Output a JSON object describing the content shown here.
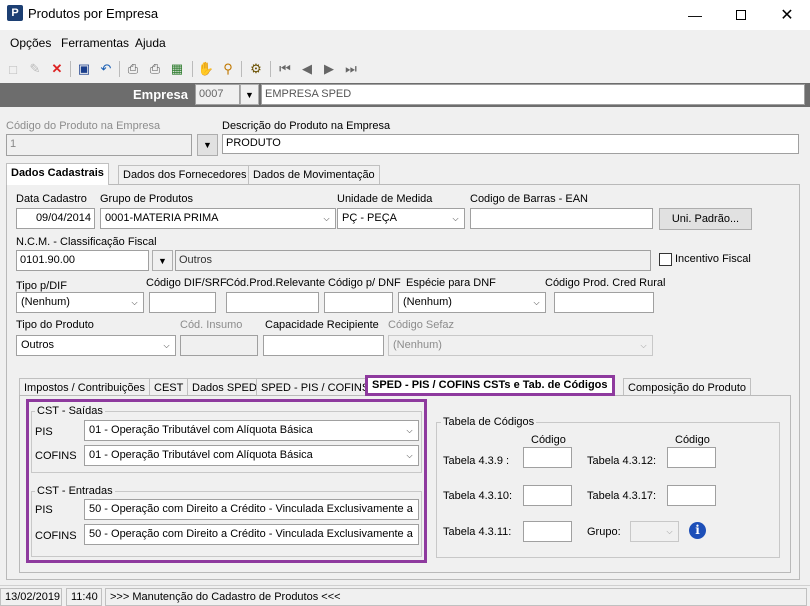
{
  "window": {
    "title": "Produtos por Empresa",
    "app_icon": "P"
  },
  "menu": {
    "opcoes": "Opções",
    "ferramentas": "Ferramentas",
    "ajuda": "Ajuda"
  },
  "empresa": {
    "label": "Empresa",
    "code": "0007",
    "name": "EMPRESA SPED"
  },
  "produto": {
    "codigo_label": "Código do Produto na Empresa",
    "codigo": "1",
    "descricao_label": "Descrição do Produto na Empresa",
    "descricao": "PRODUTO"
  },
  "main_tabs": [
    "Dados Cadastrais",
    "Dados dos Fornecedores",
    "Dados de Movimentação"
  ],
  "cadastro": {
    "data_label": "Data Cadastro",
    "data": "09/04/2014",
    "grupo_label": "Grupo de Produtos",
    "grupo": "0001-MATERIA PRIMA",
    "unidade_label": "Unidade de Medida",
    "unidade": "PÇ - PEÇA",
    "ean_label": "Codigo de Barras - EAN",
    "ean": "",
    "uni_padrao": "Uni. Padrão...",
    "ncm_label": "N.C.M. -  Classificação Fiscal",
    "ncm": "0101.90.00",
    "ncm_desc": "Outros",
    "incentivo": "Incentivo Fiscal",
    "tipo_dif_label": "Tipo p/DIF",
    "tipo_dif": "(Nenhum)",
    "cod_dif_label": "Código DIF/SRF",
    "cod_relevante_label": "Cód.Prod.Relevante",
    "cod_dnf_label": "Código p/ DNF",
    "especie_label": "Espécie para DNF",
    "especie": "(Nenhum)",
    "cred_rural_label": "Código Prod. Cred Rural",
    "tipo_produto_label": "Tipo do Produto",
    "tipo_produto": "Outros",
    "insumo_label": "Cód. Insumo",
    "capacidade_label": "Capacidade Recipiente",
    "sefaz_label": "Código Sefaz",
    "sefaz": "(Nenhum)"
  },
  "sub_tabs": [
    "Impostos / Contribuições",
    "CEST",
    "Dados SPED",
    "SPED - PIS / COFINS",
    "SPED - PIS / COFINS CSTs e Tab. de Códigos",
    "Composição do Produto"
  ],
  "cst_saidas": {
    "title": "CST - Saídas",
    "pis_label": "PIS",
    "pis": "01 - Operação Tributável com Alíquota Básica",
    "cofins_label": "COFINS",
    "cofins": "01 - Operação Tributável com Alíquota Básica"
  },
  "cst_entradas": {
    "title": "CST - Entradas",
    "pis_label": "PIS",
    "pis": "50 - Operação com Direito a Crédito - Vinculada Exclusivamente a",
    "cofins_label": "COFINS",
    "cofins": "50 - Operação com Direito a Crédito - Vinculada Exclusivamente a"
  },
  "tabela": {
    "title": "Tabela de Códigos",
    "codigo_header": "Código",
    "t439": "Tabela 4.3.9 :",
    "t4312": "Tabela 4.3.12:",
    "t4310": "Tabela 4.3.10:",
    "t4317": "Tabela 4.3.17:",
    "t4311": "Tabela 4.3.11:",
    "grupo": "Grupo:"
  },
  "status": {
    "date": "13/02/2019",
    "time": "11:40",
    "message": ">>> Manutenção do Cadastro de Produtos <<<"
  },
  "colors": {
    "highlight": "#8e3a9e",
    "empresa_bar": "#6d6d6d"
  }
}
